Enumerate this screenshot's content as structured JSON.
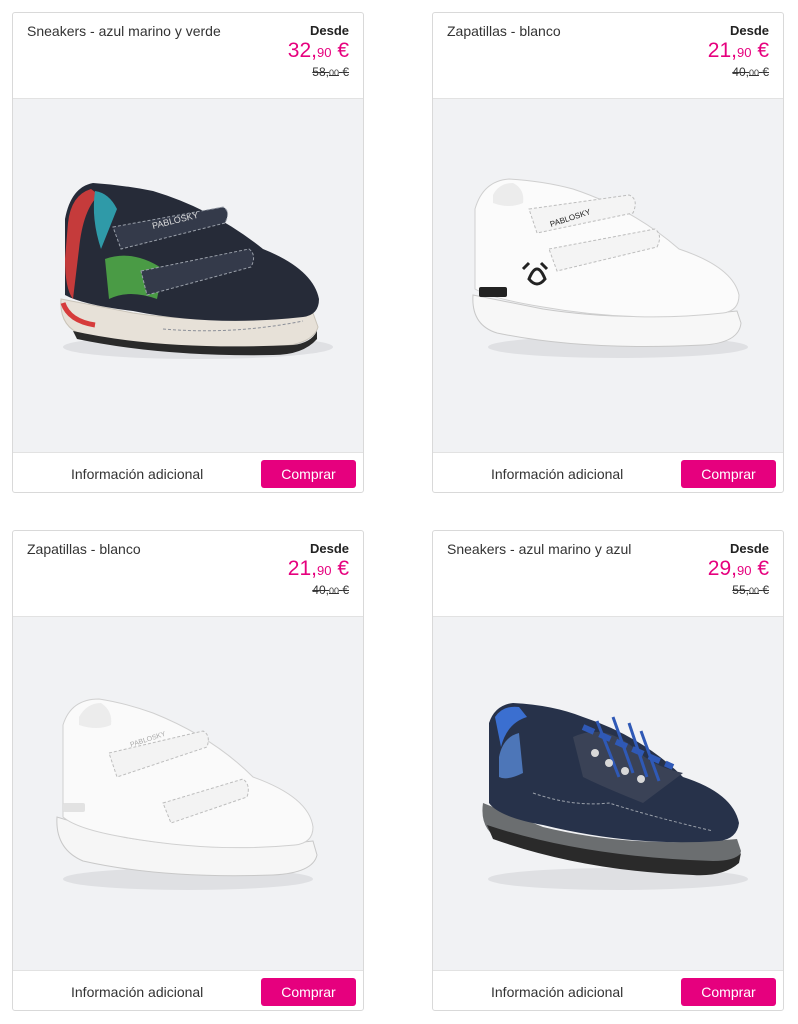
{
  "products": [
    {
      "name": "Sneakers - azul marino y verde",
      "from_label": "Desde",
      "price_int": "32,",
      "price_dec": "90",
      "currency": "€",
      "old_int": "58,",
      "old_dec": "00",
      "old_currency": "€",
      "info_label": "Información adicional",
      "buy_label": "Comprar",
      "brand_text": "PABLOSKY"
    },
    {
      "name": "Zapatillas - blanco",
      "from_label": "Desde",
      "price_int": "21,",
      "price_dec": "90",
      "currency": "€",
      "old_int": "40,",
      "old_dec": "00",
      "old_currency": "€",
      "info_label": "Información adicional",
      "buy_label": "Comprar",
      "brand_text": "PABLOSKY"
    },
    {
      "name": "Zapatillas - blanco",
      "from_label": "Desde",
      "price_int": "21,",
      "price_dec": "90",
      "currency": "€",
      "old_int": "40,",
      "old_dec": "00",
      "old_currency": "€",
      "info_label": "Información adicional",
      "buy_label": "Comprar",
      "brand_text": "PABLOSKY"
    },
    {
      "name": "Sneakers - azul marino y azul",
      "from_label": "Desde",
      "price_int": "29,",
      "price_dec": "90",
      "currency": "€",
      "old_int": "55,",
      "old_dec": "00",
      "old_currency": "€",
      "info_label": "Información adicional",
      "buy_label": "Comprar",
      "brand_text": ""
    }
  ],
  "colors": {
    "accent": "#e6007e",
    "border": "#d9d9d9",
    "image_bg": "#f1f2f4"
  }
}
